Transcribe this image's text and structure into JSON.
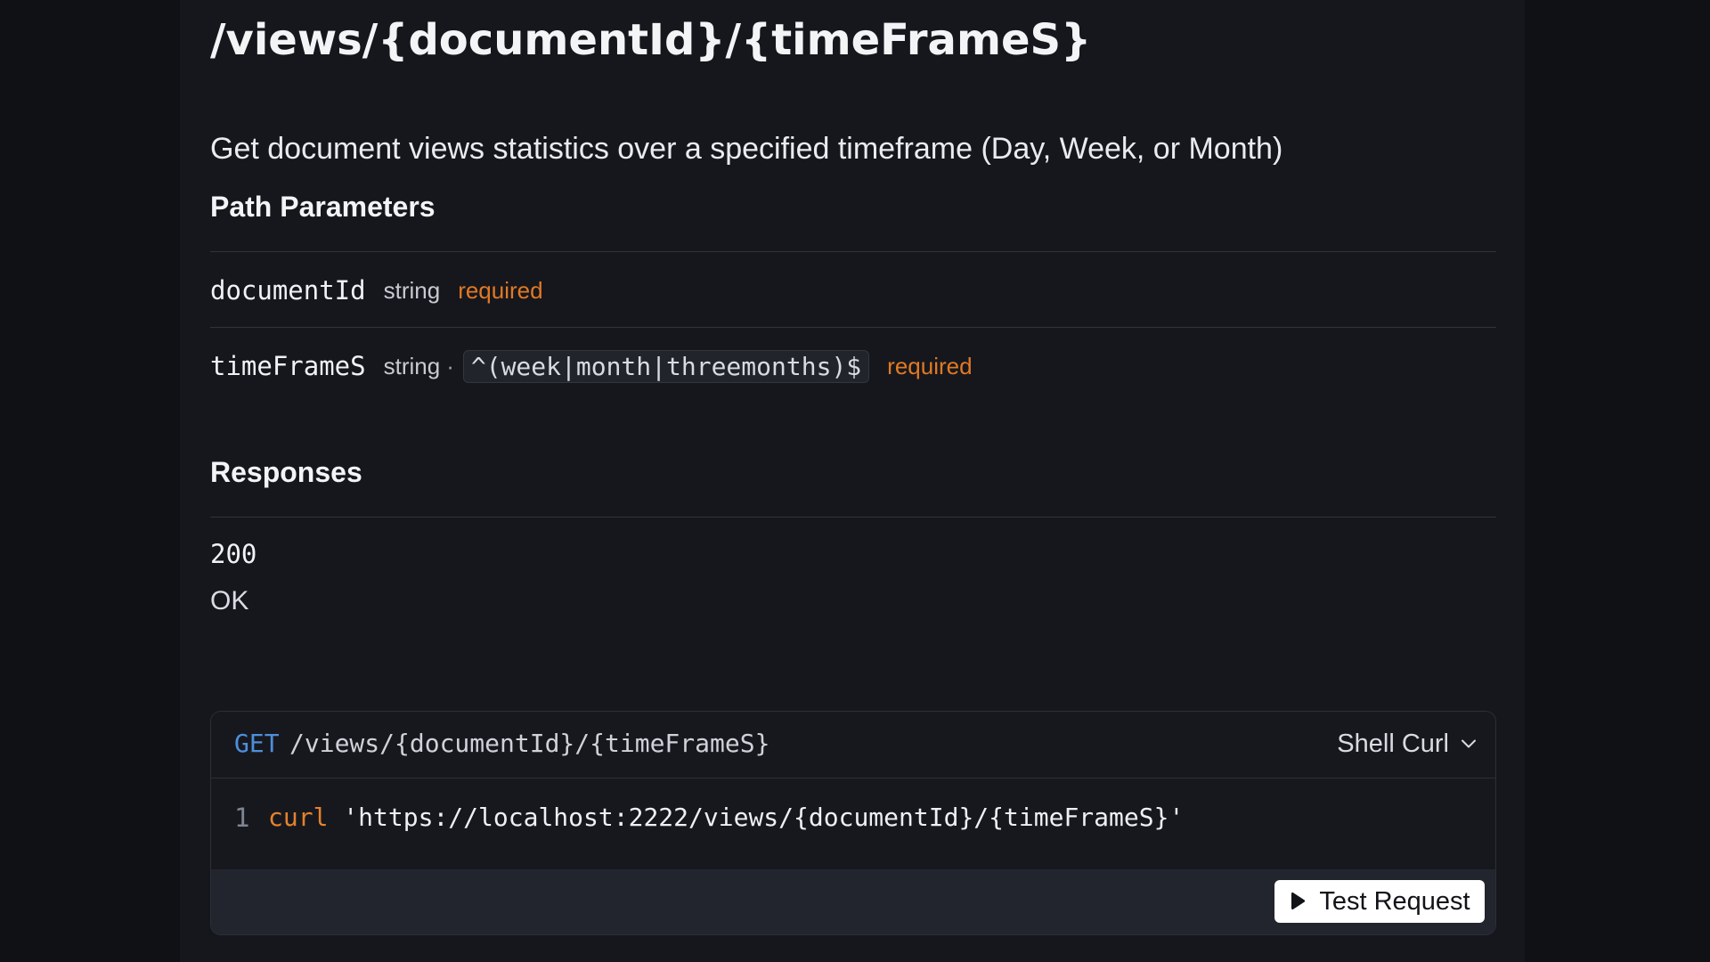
{
  "endpoint": {
    "path": "/views/{documentId}/{timeFrameS}",
    "description": "Get document views statistics over a specified timeframe (Day, Week, or Month)"
  },
  "path_parameters": {
    "heading": "Path Parameters",
    "items": [
      {
        "name": "documentId",
        "type": "string",
        "separator": "",
        "pattern": "",
        "required_label": "required"
      },
      {
        "name": "timeFrameS",
        "type": "string",
        "separator": "·",
        "pattern": "^(week|month|threemonths)$",
        "required_label": "required"
      }
    ]
  },
  "responses": {
    "heading": "Responses",
    "items": [
      {
        "code": "200",
        "description": "OK"
      }
    ]
  },
  "code_example": {
    "method": "GET",
    "path": "/views/{documentId}/{timeFrameS}",
    "language": "Shell Curl",
    "line_number": "1",
    "command": "curl",
    "url": "'https://localhost:2222/views/{documentId}/{timeFrameS}'",
    "test_button_label": "Test Request"
  },
  "colors": {
    "background": "#0f1115",
    "panel": "#16171d",
    "required": "#e17924",
    "method": "#4c8fdc",
    "curl_keyword": "#e5822d",
    "button_background": "#ffffff"
  },
  "icons": {
    "language_dropdown": "chevron-down-icon",
    "test_request": "play-icon"
  }
}
